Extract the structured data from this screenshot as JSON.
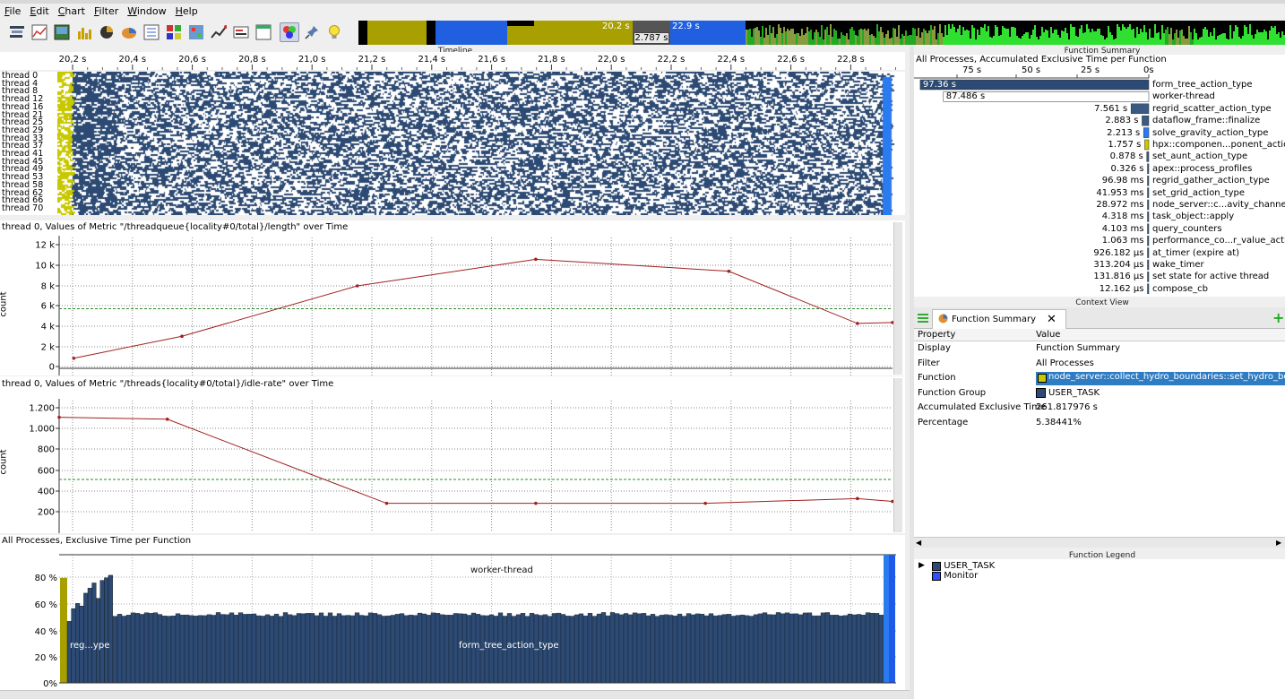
{
  "window": {
    "title": "Trace View"
  },
  "menu": [
    {
      "label": "File",
      "u": "F",
      "rest": "ile"
    },
    {
      "label": "Edit",
      "u": "E",
      "rest": "dit"
    },
    {
      "label": "Chart",
      "u": "C",
      "rest": "hart"
    },
    {
      "label": "Filter",
      "u": "F",
      "rest": "ilter"
    },
    {
      "label": "Window",
      "u": "W",
      "rest": "indow"
    },
    {
      "label": "Help",
      "u": "H",
      "rest": "elp"
    }
  ],
  "toolbar_icons": [
    "gantt-icon",
    "counters-icon",
    "image-icon",
    "histogram-icon",
    "statistics-icon",
    "pie-chart-icon",
    "list-icon",
    "grid-icon",
    "matrix-icon",
    "chart-icon",
    "summary-icon",
    "window-icon",
    "colors-icon",
    "pin-icon",
    "light-bulb-icon"
  ],
  "overview": {
    "left_label": "20.2 s",
    "center_label": "2.787 s",
    "right_label": "22.9 s"
  },
  "timeline": {
    "title": "Timeline",
    "ticks": [
      "20,2 s",
      "20,4 s",
      "20,6 s",
      "20,8 s",
      "21,0 s",
      "21,2 s",
      "21,4 s",
      "21,6 s",
      "21,8 s",
      "22,0 s",
      "22,2 s",
      "22,4 s",
      "22,6 s",
      "22,8 s"
    ],
    "threads": [
      "thread 0",
      "thread 4",
      "thread 8",
      "thread 12",
      "thread 16",
      "thread 21",
      "thread 25",
      "thread 29",
      "thread 33",
      "thread 37",
      "thread 41",
      "thread 45",
      "thread 49",
      "thread 53",
      "thread 58",
      "thread 62",
      "thread 66",
      "thread 70"
    ]
  },
  "metric1": {
    "title": "thread 0, Values of Metric \"/threadqueue{locality#0/total}/length\" over Time",
    "ylabel": "count",
    "yticks": [
      "12 k",
      "10 k",
      "8 k",
      "6 k",
      "4 k",
      "2 k",
      "0"
    ]
  },
  "metric2": {
    "title": "thread 0, Values of Metric \"/threads{locality#0/total}/idle-rate\" over Time",
    "ylabel": "count",
    "yticks": [
      "1.200",
      "1.000",
      "800",
      "600",
      "400",
      "200"
    ]
  },
  "exclusive": {
    "title": "All Processes, Exclusive Time per Function",
    "yticks": [
      "80 %",
      "60 %",
      "40 %",
      "20 %",
      "0%"
    ],
    "labels": {
      "worker": "worker-thread",
      "regrid": "reg...ype",
      "form": "form_tree_action_type"
    }
  },
  "function_summary": {
    "panel_title": "Function Summary",
    "header": "All Processes, Accumulated Exclusive Time per Function",
    "axis": [
      "75 s",
      "50 s",
      "25 s",
      "0s"
    ],
    "rows": [
      {
        "value": "97.36 s",
        "name": "form_tree_action_type",
        "color": "#2c4a73"
      },
      {
        "value": "87.486 s",
        "name": "worker-thread",
        "color": "#ffffff"
      },
      {
        "value": "7.561 s",
        "name": "regrid_scatter_action_type",
        "color": "#3a5a82"
      },
      {
        "value": "2.883 s",
        "name": "dataflow_frame::finalize",
        "color": "#3a5a82"
      },
      {
        "value": "2.213 s",
        "name": "solve_gravity_action_type",
        "color": "#2a7af0"
      },
      {
        "value": "1.757 s",
        "name": "hpx::componen...ponent_action",
        "color": "#c8c800"
      },
      {
        "value": "0.878 s",
        "name": "set_aunt_action_type",
        "color": "#3a5a82"
      },
      {
        "value": "0.326 s",
        "name": "apex::process_profiles",
        "color": "#3a5a82"
      },
      {
        "value": "96.98 ms",
        "name": "regrid_gather_action_type",
        "color": "#3a5a82"
      },
      {
        "value": "41.953 ms",
        "name": "set_grid_action_type",
        "color": "#3a5a82"
      },
      {
        "value": "28.972 ms",
        "name": "node_server::c...avity_channels",
        "color": "#3a5a82"
      },
      {
        "value": "4.318 ms",
        "name": "task_object::apply",
        "color": "#3a5a82"
      },
      {
        "value": "4.103 ms",
        "name": "query_counters",
        "color": "#3a5a82"
      },
      {
        "value": "1.063 ms",
        "name": "performance_co...r_value_action",
        "color": "#3a5a82"
      },
      {
        "value": "926.182 µs",
        "name": "at_timer (expire at)",
        "color": "#3a5a82"
      },
      {
        "value": "313.204 µs",
        "name": "wake_timer",
        "color": "#3a5a82"
      },
      {
        "value": "131.816 µs",
        "name": "set state for active thread",
        "color": "#3a5a82"
      },
      {
        "value": "12.162 µs",
        "name": "compose_cb",
        "color": "#3a5a82"
      }
    ]
  },
  "context_view": {
    "title": "Context View",
    "tab_label": "Function Summary",
    "col_property": "Property",
    "col_value": "Value",
    "rows": [
      {
        "property": "Display",
        "value": "Function Summary"
      },
      {
        "property": "Filter",
        "value": "All Processes"
      },
      {
        "property": "Function",
        "value": "node_server::collect_hydro_boundaries::set_hydro_bounda"
      },
      {
        "property": "Function Group",
        "value": "USER_TASK"
      },
      {
        "property": "Accumulated Exclusive Time",
        "value": "261.817976 s"
      },
      {
        "property": "Percentage",
        "value": "5.38441%"
      }
    ]
  },
  "legend": {
    "title": "Function Legend",
    "items": [
      {
        "label": "USER_TASK",
        "color": "#2c4a73"
      },
      {
        "label": "Monitor",
        "color": "#3050ff"
      }
    ]
  },
  "chart_data": [
    {
      "type": "line",
      "title": "thread 0, Values of Metric \"/threadqueue{locality#0/total}/length\" over Time",
      "ylabel": "count",
      "x": [
        20.15,
        20.52,
        21.12,
        21.73,
        22.39,
        22.83,
        22.95
      ],
      "y": [
        600,
        3000,
        8500,
        11400,
        10100,
        4400,
        4500
      ],
      "xlim": [
        20.1,
        22.95
      ],
      "ylim": [
        -500,
        13000
      ],
      "threshold": 6000
    },
    {
      "type": "line",
      "title": "thread 0, Values of Metric \"/threads{locality#0/total}/idle-rate\" over Time",
      "ylabel": "count",
      "x": [
        20.1,
        20.47,
        21.22,
        21.73,
        22.31,
        22.83,
        22.95
      ],
      "y": [
        1200,
        1180,
        300,
        300,
        300,
        350,
        320
      ],
      "xlim": [
        20.1,
        22.95
      ],
      "ylim": [
        100,
        1300
      ],
      "threshold": 550
    }
  ]
}
